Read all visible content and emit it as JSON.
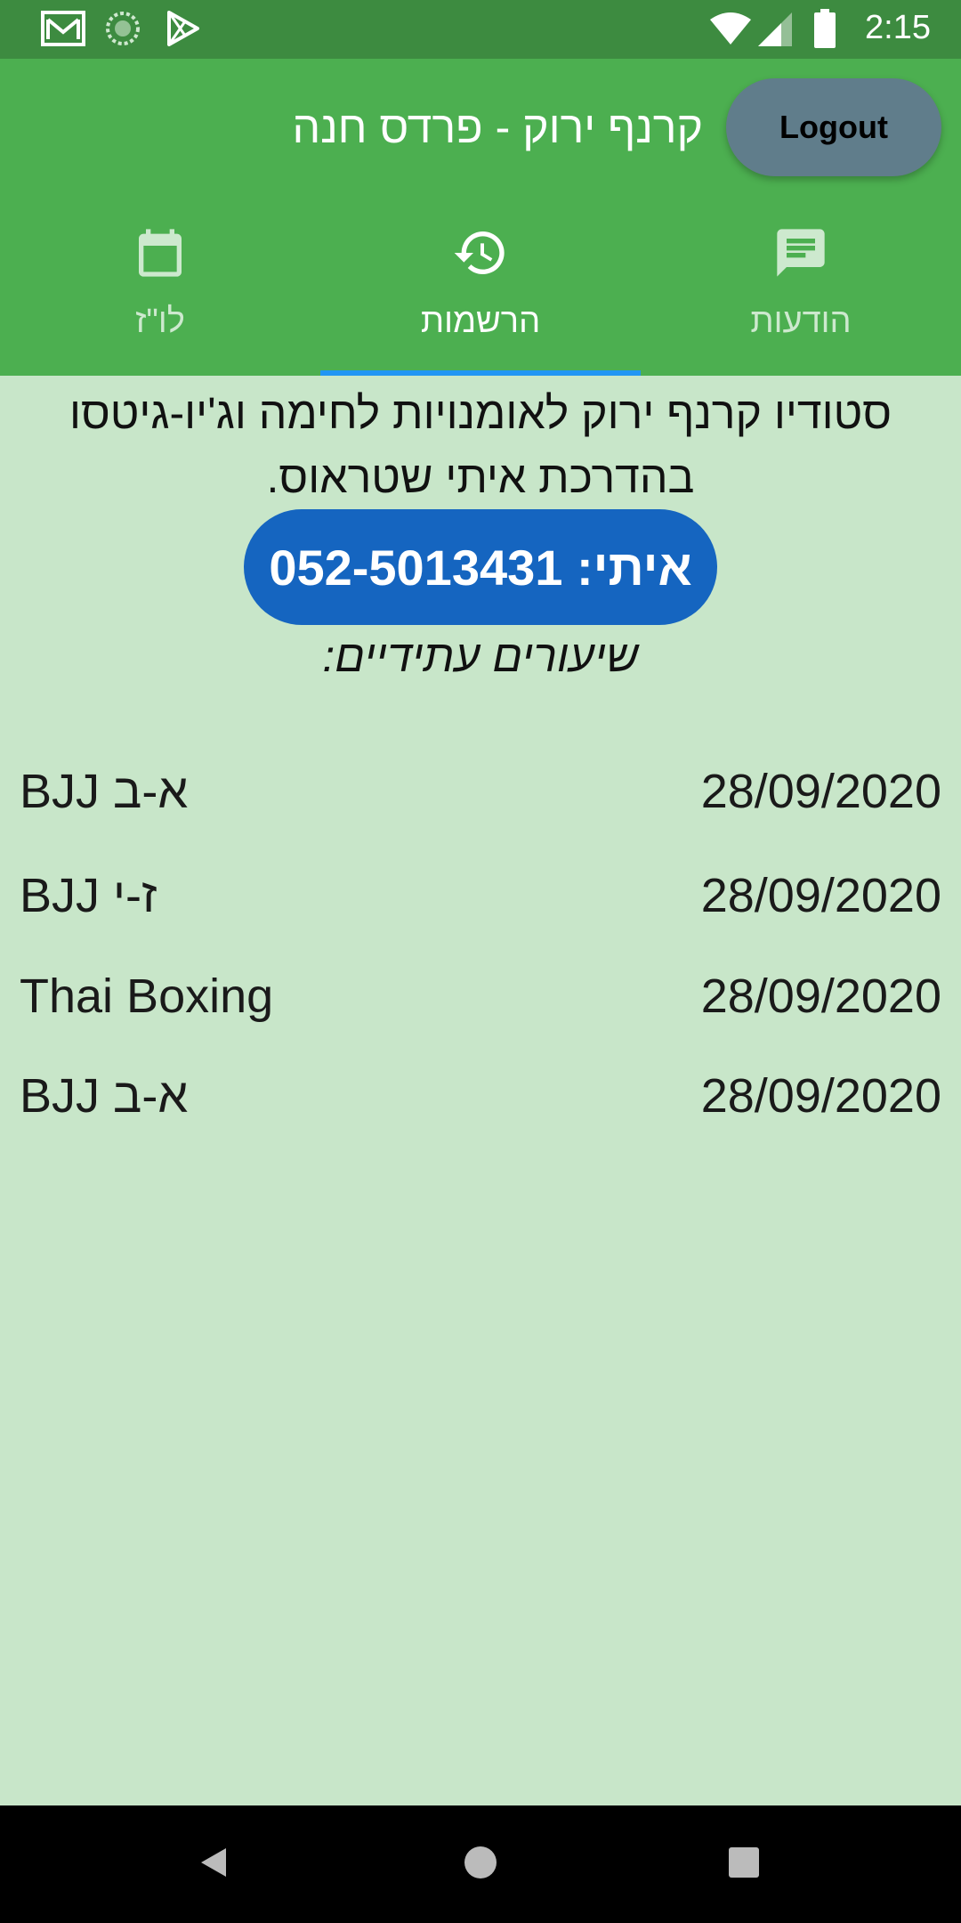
{
  "status_bar": {
    "time": "2:15",
    "icons_left": [
      "gmail-icon",
      "sync-icon",
      "play-store-icon"
    ],
    "icons_right": [
      "wifi-icon",
      "signal-icon",
      "battery-icon"
    ]
  },
  "app_bar": {
    "title": "קרנף ירוק - פרדס חנה",
    "logout_label": "Logout",
    "colors": {
      "background": "#4CAF50",
      "logout_button": "#607D8B",
      "tab_indicator": "#2196F3"
    }
  },
  "tabs": [
    {
      "label": "הודעות",
      "icon": "message-icon",
      "selected": false
    },
    {
      "label": "הרשמות",
      "icon": "history-icon",
      "selected": true
    },
    {
      "label": "לו\"ז",
      "icon": "calendar-icon",
      "selected": false
    }
  ],
  "main": {
    "description": "סטודיו קרנף ירוק לאומנויות לחימה וג'יו-גיטסו בהדרכת איתי שטראוס.",
    "phone_button_label": "איתי: 052-5013431",
    "future_heading": "שיעורים עתידיים:",
    "classes": [
      {
        "name": "BJJ א-ב",
        "date": "28/09/2020"
      },
      {
        "name": "BJJ ז-י",
        "date": "28/09/2020"
      },
      {
        "name": "Thai Boxing",
        "date": "28/09/2020"
      },
      {
        "name": "BJJ א-ב",
        "date": "28/09/2020"
      }
    ]
  },
  "nav_bar": {
    "buttons": [
      "back-icon",
      "home-icon",
      "recents-icon"
    ]
  }
}
